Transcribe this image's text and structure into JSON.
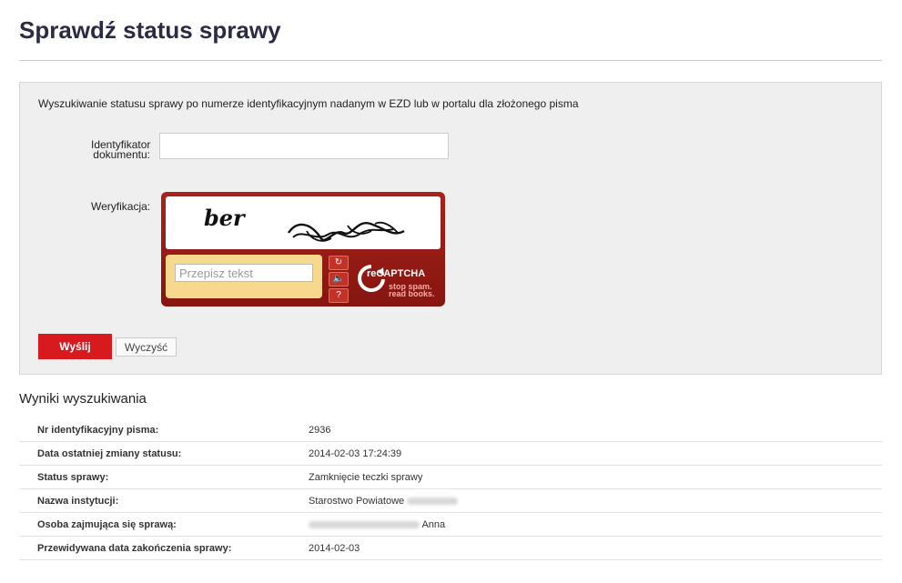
{
  "page": {
    "title": "Sprawdź status sprawy"
  },
  "search": {
    "description": "Wyszukiwanie statusu sprawy po numerze identyfikacyjnym nadanym w EZD lub w portalu dla złożonego pisma",
    "id_label": "Identyfikator dokumentu:",
    "id_value": "",
    "verification_label": "Weryfikacja:",
    "captcha": {
      "image_text": "ber",
      "placeholder": "Przepisz tekst",
      "brand": "reCAPTCHA",
      "tagline": "stop spam. read books.",
      "reload_icon": "refresh-icon",
      "audio_icon": "speaker-icon",
      "help_icon": "help-icon"
    },
    "submit_label": "Wyślij",
    "clear_label": "Wyczyść"
  },
  "results": {
    "heading": "Wyniki wyszukiwania",
    "rows": [
      {
        "label": "Nr identyfikacyjny pisma:",
        "value": "2936"
      },
      {
        "label": "Data ostatniej zmiany statusu:",
        "value": "2014-02-03 17:24:39"
      },
      {
        "label": "Status sprawy:",
        "value": "Zamknięcie teczki sprawy"
      },
      {
        "label": "Nazwa instytucji:",
        "value": "Starostwo Powiatowe"
      },
      {
        "label": "Osoba zajmująca się sprawą:",
        "value": "Anna"
      },
      {
        "label": "Przewidywana data zakończenia sprawy:",
        "value": "2014-02-03"
      }
    ]
  },
  "colors": {
    "accent": "#d81a1f",
    "title": "#2b2b45",
    "panel": "#efefef",
    "captcha": "#9b1c16"
  }
}
